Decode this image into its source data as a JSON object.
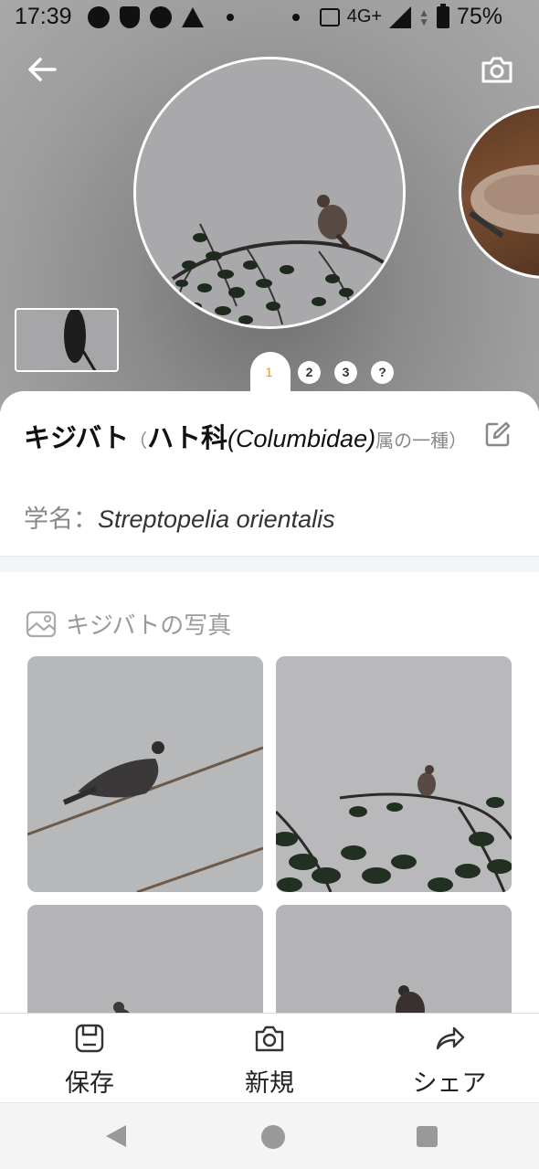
{
  "status_bar": {
    "time": "17:39",
    "network": "4G+",
    "battery": "75%",
    "icons": [
      "facebook-icon",
      "person-add-icon",
      "running-icon",
      "warning-icon",
      "dot",
      "dot",
      "vibrate-icon",
      "signal-icon",
      "battery-icon"
    ]
  },
  "hero": {
    "back_icon": "arrow-left-icon",
    "camera_icon": "camera-icon",
    "pager": [
      "1",
      "2",
      "3",
      "?"
    ],
    "active_page": "1"
  },
  "species": {
    "name": "キジバト",
    "paren_open": "（",
    "family": "ハト科",
    "family_latin": "(Columbidae)",
    "suffix": "属の一種）",
    "scientific_label": "学名：",
    "scientific_name": "Streptopelia orientalis"
  },
  "photos": {
    "heading": "キジバトの写真"
  },
  "bottom_bar": {
    "save_label": "保存",
    "new_label": "新規",
    "share_label": "シェア"
  },
  "colors": {
    "accent": "#e39a28",
    "card_divider": "#f2f6f9"
  }
}
